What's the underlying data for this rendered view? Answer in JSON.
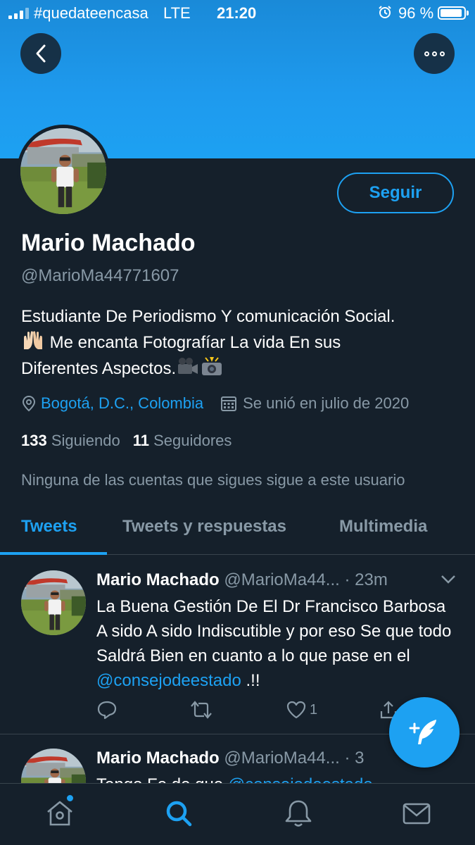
{
  "status_bar": {
    "carrier": "#quedateencasa",
    "network": "LTE",
    "time": "21:20",
    "battery": "96 %"
  },
  "profile": {
    "name": "Mario Machado",
    "handle": "@MarioMa44771607",
    "follow_label": "Seguir",
    "bio_line1": "Estudiante De Periodismo Y comunicación Social.",
    "bio_line2": " Me encanta Fotografíar La vida En sus",
    "bio_line3": "Diferentes Aspectos.",
    "location": "Bogotá, D.C., Colombia",
    "joined": "Se unió en julio de 2020",
    "following_count": "133",
    "following_label": "Siguiendo",
    "followers_count": "11",
    "followers_label": "Seguidores",
    "followed_by_note": "Ninguna de las cuentas que sigues sigue a este usuario"
  },
  "tabs": [
    {
      "label": "Tweets",
      "active": true
    },
    {
      "label": "Tweets y respuestas",
      "active": false
    },
    {
      "label": "Multimedia",
      "active": false
    }
  ],
  "tweets": [
    {
      "name": "Mario Machado",
      "handle": "@MarioMa44...",
      "time": "· 23m",
      "text": "La Buena Gestión De El Dr Francisco Barbosa  A sido  A sido Indiscutible y por eso Se que todo Saldrá Bien en cuanto a lo que pase en el ",
      "mention": "@consejodeestado",
      "text_end": " .!!",
      "likes": "1"
    },
    {
      "name": "Mario Machado",
      "handle": "@MarioMa44...",
      "time": "· 3",
      "text": "Tengo Fe  de que ",
      "mention": "@consejodeestado"
    }
  ],
  "colors": {
    "accent": "#1da1f2",
    "background": "#15202b",
    "muted": "#8899a6",
    "border": "#38444d"
  },
  "icons": {
    "back": "chevron-left-icon",
    "more": "more-dots-icon",
    "location": "location-pin-icon",
    "calendar": "calendar-icon",
    "reply": "reply-icon",
    "retweet": "retweet-icon",
    "like": "heart-icon",
    "share": "share-icon",
    "compose": "compose-tweet-icon",
    "home": "home-icon",
    "search": "search-icon",
    "notifications": "bell-icon",
    "messages": "mail-icon"
  }
}
